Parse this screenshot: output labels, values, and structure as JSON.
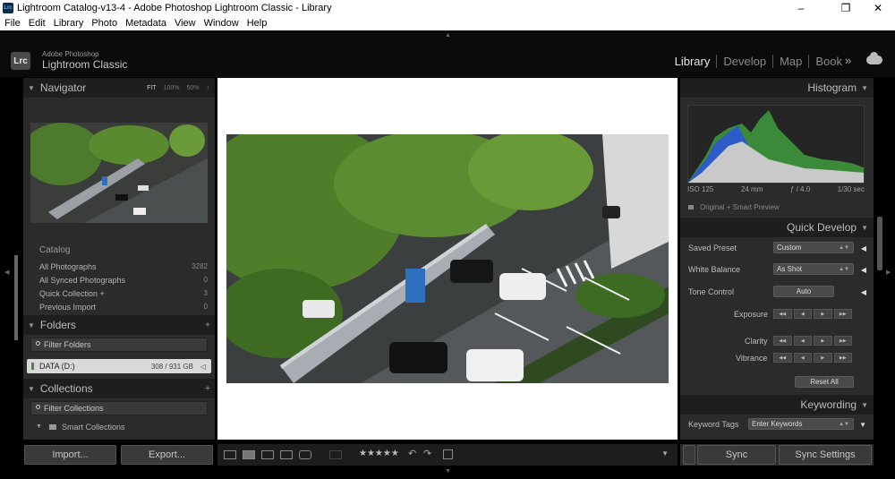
{
  "window": {
    "title": "Lightroom Catalog-v13-4 - Adobe Photoshop Lightroom Classic - Library",
    "icon_text": "Lrc",
    "min": "–",
    "max": "❐",
    "close": "✕"
  },
  "menu": [
    "File",
    "Edit",
    "Library",
    "Photo",
    "Metadata",
    "View",
    "Window",
    "Help"
  ],
  "brand": {
    "line1": "Adobe Photoshop",
    "line2": "Lightroom Classic",
    "badge": "Lrc"
  },
  "modules": [
    {
      "label": "Library",
      "active": true
    },
    {
      "label": "Develop",
      "active": false
    },
    {
      "label": "Map",
      "active": false
    },
    {
      "label": "Book",
      "active": false
    }
  ],
  "modules_more": "»",
  "navigator": {
    "title": "Navigator",
    "zoom": [
      "FIT",
      "100%",
      "50%"
    ],
    "more": "↕"
  },
  "catalog": {
    "title": "Catalog",
    "items": [
      {
        "label": "All Photographs",
        "count": "3282"
      },
      {
        "label": "All Synced Photographs",
        "count": "0"
      },
      {
        "label": "Quick Collection +",
        "count": "3"
      },
      {
        "label": "Previous Import",
        "count": "0"
      }
    ]
  },
  "folders": {
    "title": "Folders",
    "filter": "Filter Folders",
    "drive": {
      "label": "DATA (D:)",
      "size": "308 / 931 GB"
    },
    "add": "+"
  },
  "collections": {
    "title": "Collections",
    "filter": "Filter Collections",
    "smart": "Smart Collections",
    "add": "+"
  },
  "buttons": {
    "import": "Import...",
    "export": "Export..."
  },
  "histogram": {
    "title": "Histogram",
    "iso": "ISO 125",
    "focal": "24 mm",
    "fstop": "ƒ / 4.0",
    "shutter": "1/30 sec",
    "preview": "Original + Smart Preview"
  },
  "quick_develop": {
    "title": "Quick Develop",
    "saved_preset": {
      "label": "Saved Preset",
      "value": "Custom"
    },
    "white_balance": {
      "label": "White Balance",
      "value": "As Shot"
    },
    "tone_control": {
      "label": "Tone Control",
      "button": "Auto"
    },
    "exposure": "Exposure",
    "clarity": "Clarity",
    "vibrance": "Vibrance",
    "reset": "Reset All"
  },
  "keywording": {
    "title": "Keywording",
    "label": "Keyword Tags",
    "value": "Enter Keywords"
  },
  "sync": {
    "sync": "Sync",
    "settings": "Sync Settings"
  },
  "stars": "★★★★★",
  "stepper_glyphs": [
    "◀◀",
    "◀",
    "▶",
    "▶▶"
  ],
  "colors": {
    "bg": "#2b2b2b",
    "header": "#1e1e1e",
    "active_text": "#e6e6e6"
  }
}
